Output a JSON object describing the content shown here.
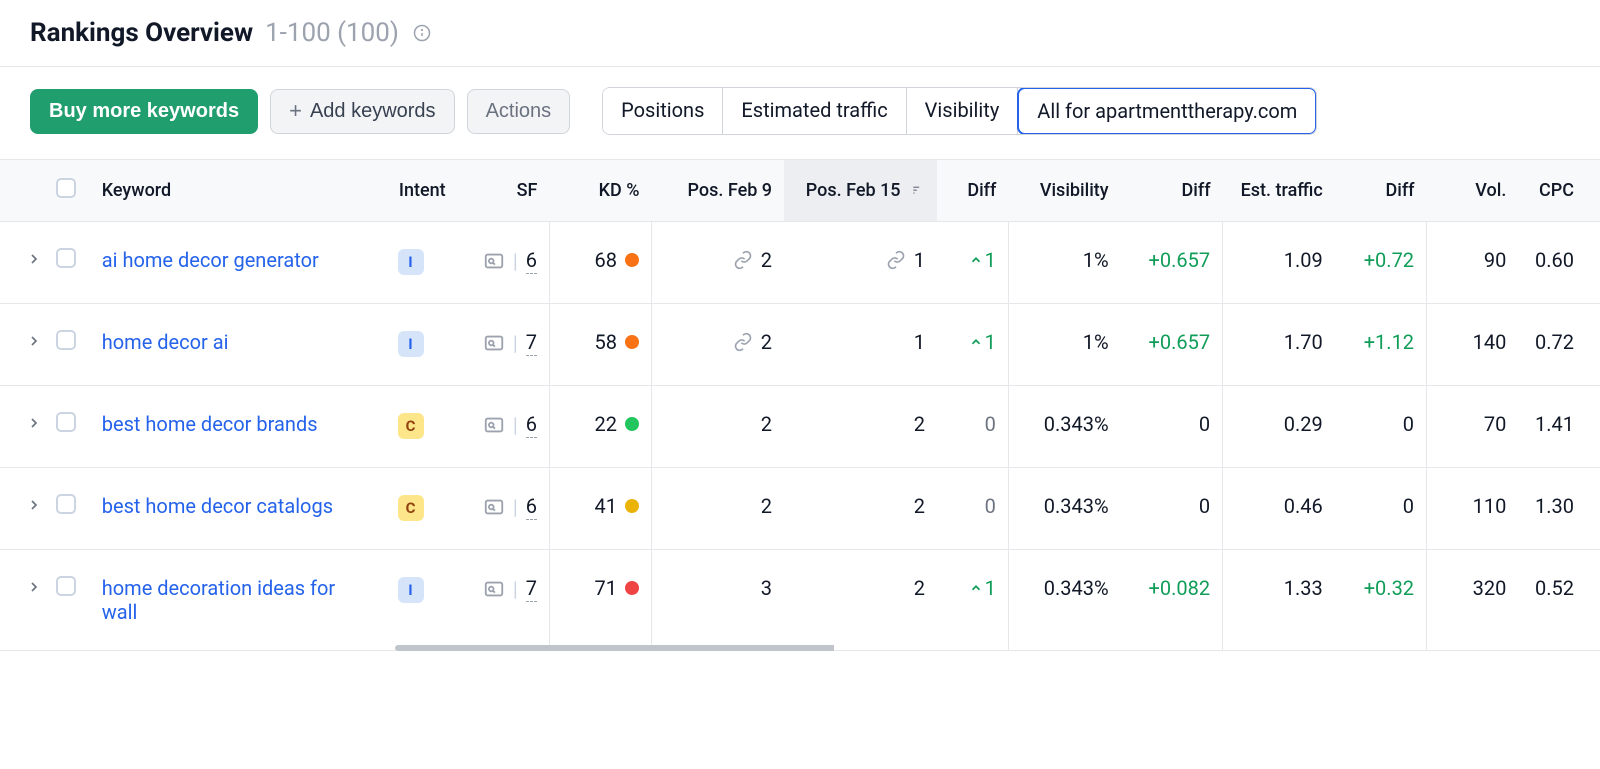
{
  "header": {
    "title": "Rankings Overview",
    "range": "1-100 (100)"
  },
  "toolbar": {
    "buy": "Buy more keywords",
    "add": "Add keywords",
    "actions": "Actions",
    "seg": [
      "Positions",
      "Estimated traffic",
      "Visibility",
      "All for apartmenttherapy.com"
    ],
    "seg_active_index": 3
  },
  "columns": {
    "keyword": "Keyword",
    "intent": "Intent",
    "sf": "SF",
    "kd": "KD %",
    "pos1": "Pos. Feb 9",
    "pos2": "Pos. Feb 15",
    "diff": "Diff",
    "visibility": "Visibility",
    "traffic": "Est. traffic",
    "vol": "Vol.",
    "cpc": "CPC"
  },
  "rows": [
    {
      "keyword": "ai home decor generator",
      "intent": "I",
      "sf": "6",
      "kd": "68",
      "kd_color": "#f97316",
      "pos1": "2",
      "pos1_link": true,
      "pos2": "1",
      "pos2_link": true,
      "diff1": "1",
      "diff1_up": true,
      "visibility": "1%",
      "diff2": "+0.657",
      "diff2_green": true,
      "traffic": "1.09",
      "diff3": "+0.72",
      "diff3_green": true,
      "vol": "90",
      "cpc": "0.60"
    },
    {
      "keyword": "home decor ai",
      "intent": "I",
      "sf": "7",
      "kd": "58",
      "kd_color": "#f97316",
      "pos1": "2",
      "pos1_link": true,
      "pos2": "1",
      "pos2_link": false,
      "diff1": "1",
      "diff1_up": true,
      "visibility": "1%",
      "diff2": "+0.657",
      "diff2_green": true,
      "traffic": "1.70",
      "diff3": "+1.12",
      "diff3_green": true,
      "vol": "140",
      "cpc": "0.72"
    },
    {
      "keyword": "best home decor brands",
      "intent": "C",
      "sf": "6",
      "kd": "22",
      "kd_color": "#22c55e",
      "pos1": "2",
      "pos1_link": false,
      "pos2": "2",
      "pos2_link": false,
      "diff1": "0",
      "diff1_up": false,
      "visibility": "0.343%",
      "diff2": "0",
      "diff2_green": false,
      "traffic": "0.29",
      "diff3": "0",
      "diff3_green": false,
      "vol": "70",
      "cpc": "1.41"
    },
    {
      "keyword": "best home decor catalogs",
      "intent": "C",
      "sf": "6",
      "kd": "41",
      "kd_color": "#eab308",
      "pos1": "2",
      "pos1_link": false,
      "pos2": "2",
      "pos2_link": false,
      "diff1": "0",
      "diff1_up": false,
      "visibility": "0.343%",
      "diff2": "0",
      "diff2_green": false,
      "traffic": "0.46",
      "diff3": "0",
      "diff3_green": false,
      "vol": "110",
      "cpc": "1.30"
    },
    {
      "keyword": "home decoration ideas for wall",
      "intent": "I",
      "sf": "7",
      "kd": "71",
      "kd_color": "#ef4444",
      "pos1": "3",
      "pos1_link": false,
      "pos2": "2",
      "pos2_link": false,
      "diff1": "1",
      "diff1_up": true,
      "visibility": "0.343%",
      "diff2": "+0.082",
      "diff2_green": true,
      "traffic": "1.33",
      "diff3": "+0.32",
      "diff3_green": true,
      "vol": "320",
      "cpc": "0.52"
    }
  ]
}
